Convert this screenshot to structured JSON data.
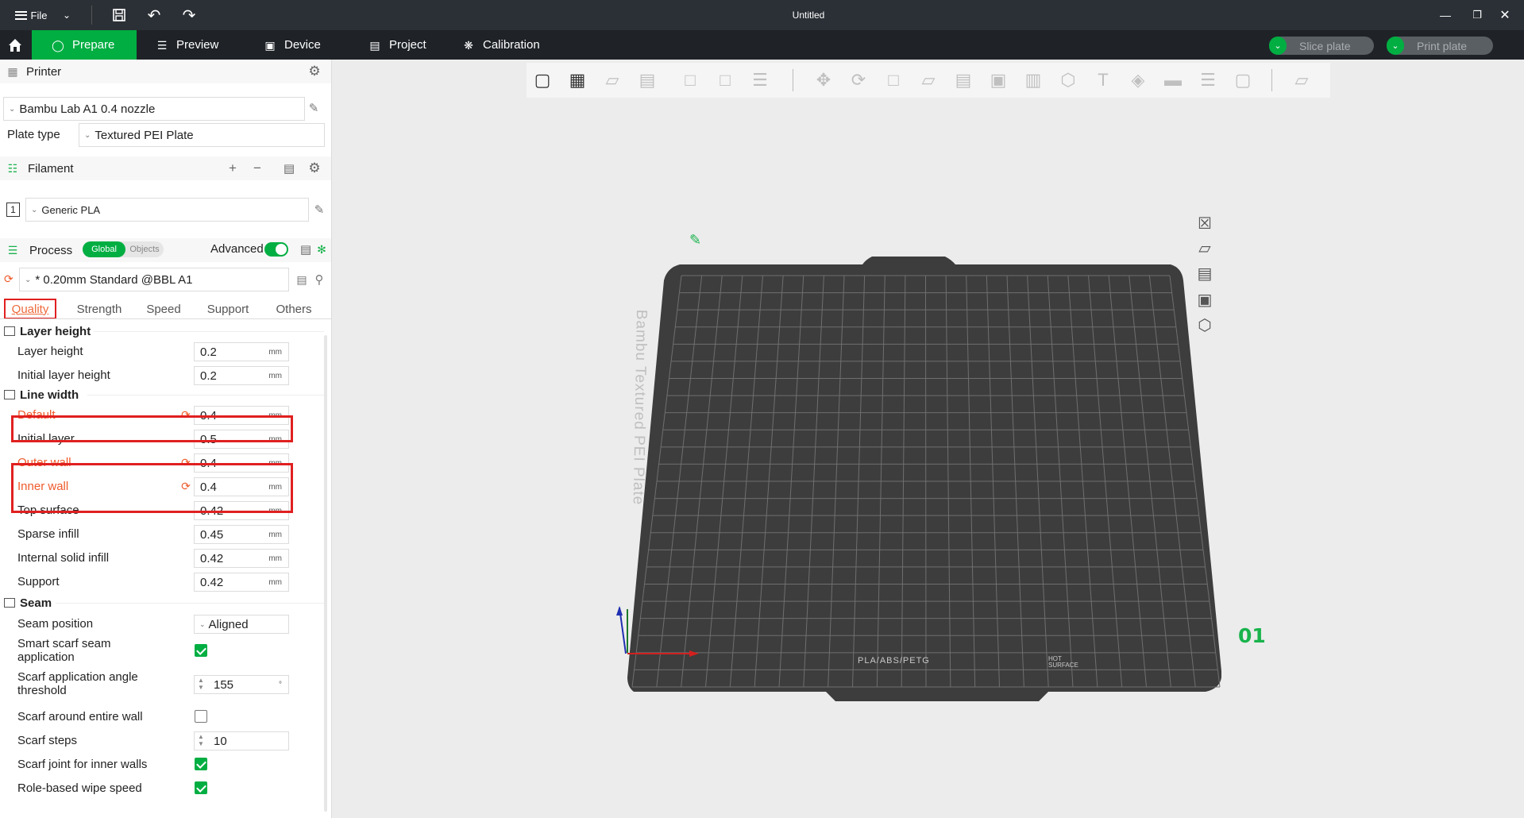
{
  "titlebar": {
    "file_label": "File",
    "title": "Untitled",
    "min_icon": "minimize-icon",
    "max_icon": "restore-icon",
    "close_icon": "close-icon"
  },
  "nav": {
    "tabs": [
      {
        "label": "Prepare",
        "icon": "cube-icon",
        "active": true
      },
      {
        "label": "Preview",
        "icon": "layers-icon"
      },
      {
        "label": "Device",
        "icon": "device-icon"
      },
      {
        "label": "Project",
        "icon": "project-icon"
      },
      {
        "label": "Calibration",
        "icon": "calibration-icon"
      }
    ],
    "slice_label": "Slice plate",
    "print_label": "Print plate",
    "accent": "#00ae42"
  },
  "printer": {
    "section_title": "Printer",
    "name": "Bambu Lab A1 0.4 nozzle",
    "plate_type_label": "Plate type",
    "plate_type": "Textured PEI Plate"
  },
  "filament": {
    "section_title": "Filament",
    "slot": "1",
    "name": "Generic PLA"
  },
  "process": {
    "section_title": "Process",
    "toggle_global": "Global",
    "toggle_objects": "Objects",
    "advanced_label": "Advanced",
    "advanced_on": true,
    "preset": "* 0.20mm Standard @BBL A1",
    "tabs": [
      "Quality",
      "Strength",
      "Speed",
      "Support",
      "Others"
    ],
    "active_tab": "Quality"
  },
  "quality": {
    "layer_height_group": "Layer height",
    "line_width_group": "Line width",
    "seam_group": "Seam",
    "unit": "mm",
    "rows": {
      "layer_height": {
        "label": "Layer height",
        "value": "0.2"
      },
      "initial_layer_height": {
        "label": "Initial layer height",
        "value": "0.2"
      },
      "default": {
        "label": "Default",
        "value": "0.4",
        "modified": true
      },
      "initial_layer": {
        "label": "Initial layer",
        "value": "0.5"
      },
      "outer_wall": {
        "label": "Outer wall",
        "value": "0.4",
        "modified": true
      },
      "inner_wall": {
        "label": "Inner wall",
        "value": "0.4",
        "modified": true
      },
      "top_surface": {
        "label": "Top surface",
        "value": "0.42"
      },
      "sparse_infill": {
        "label": "Sparse infill",
        "value": "0.45"
      },
      "internal_solid_infill": {
        "label": "Internal solid infill",
        "value": "0.42"
      },
      "support": {
        "label": "Support",
        "value": "0.42"
      },
      "seam_position": {
        "label": "Seam position",
        "value": "Aligned"
      },
      "smart_scarf": {
        "label": "Smart scarf seam application",
        "checked": true
      },
      "scarf_angle": {
        "label": "Scarf application angle threshold",
        "value": "155",
        "unit": "°"
      },
      "scarf_entire_wall": {
        "label": "Scarf around entire wall",
        "checked": false
      },
      "scarf_steps": {
        "label": "Scarf steps",
        "value": "10"
      },
      "scarf_inner_walls": {
        "label": "Scarf joint for inner walls",
        "checked": true
      },
      "role_wipe_speed": {
        "label": "Role-based wipe speed",
        "checked": true
      }
    }
  },
  "plate": {
    "name": "Bambu Textured PEI Plate",
    "number": "01",
    "footer": "PLA/ABS/PETG",
    "surface_line1": "HOT",
    "surface_line2": "SURFACE",
    "color": "#3d3d3d"
  },
  "toolbar3d": {
    "tools": [
      "add-object-icon",
      "grid-icon",
      "auto-orient-icon",
      "arrange-icon",
      "split-objects-icon",
      "split-parts-icon",
      "layers-edit-icon",
      "move-icon",
      "rotate-icon",
      "scale-icon",
      "lay-on-face-icon",
      "cut-icon",
      "boolean-icon",
      "support-paint-icon",
      "seam-paint-icon",
      "text-icon",
      "color-paint-icon",
      "measure-icon",
      "assembly-icon",
      "view-fit-icon",
      "variable-layer-icon"
    ]
  }
}
